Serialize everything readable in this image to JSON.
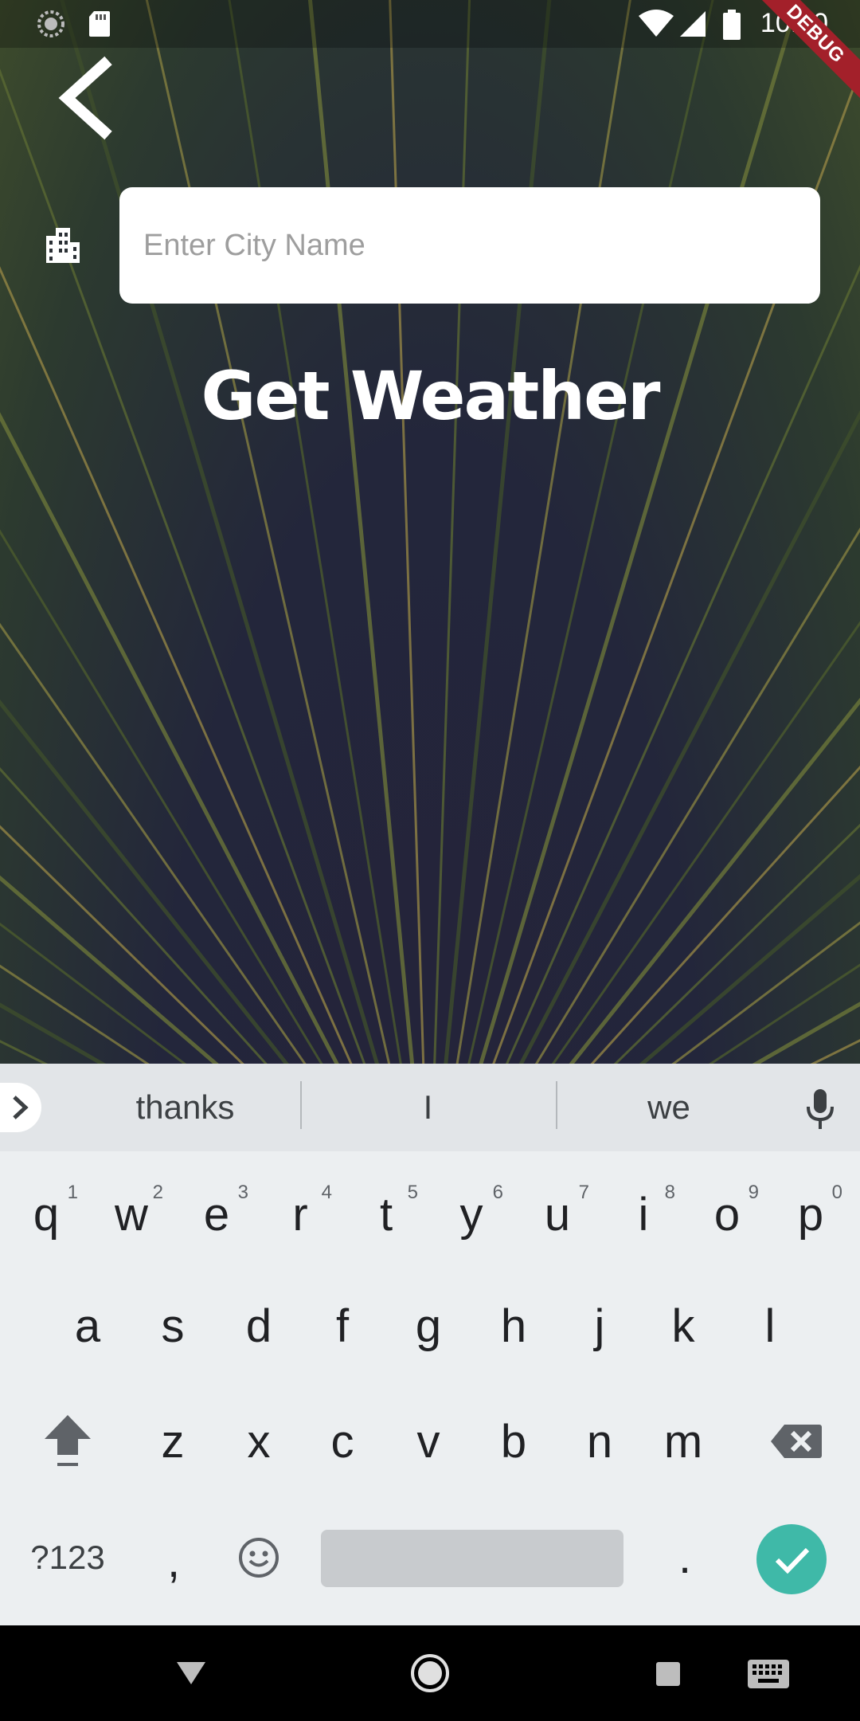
{
  "status_bar": {
    "time": "10:20",
    "icons": [
      "sync-icon",
      "sd-card-icon",
      "wifi-icon",
      "signal-icon",
      "battery-icon"
    ],
    "debug_label": "DEBUG"
  },
  "app": {
    "back_icon": "chevron-left-icon",
    "city_icon": "city-building-icon",
    "city_input": {
      "placeholder": "Enter City Name",
      "value": ""
    },
    "get_weather_label": "Get Weather",
    "colors": {
      "text": "#ffffff",
      "input_bg": "#ffffff"
    }
  },
  "keyboard": {
    "suggestions": [
      "thanks",
      "I",
      "we"
    ],
    "row1": [
      {
        "key": "q",
        "hint": "1"
      },
      {
        "key": "w",
        "hint": "2"
      },
      {
        "key": "e",
        "hint": "3"
      },
      {
        "key": "r",
        "hint": "4"
      },
      {
        "key": "t",
        "hint": "5"
      },
      {
        "key": "y",
        "hint": "6"
      },
      {
        "key": "u",
        "hint": "7"
      },
      {
        "key": "i",
        "hint": "8"
      },
      {
        "key": "o",
        "hint": "9"
      },
      {
        "key": "p",
        "hint": "0"
      }
    ],
    "row2": [
      "a",
      "s",
      "d",
      "f",
      "g",
      "h",
      "j",
      "k",
      "l"
    ],
    "row3": [
      "z",
      "x",
      "c",
      "v",
      "b",
      "n",
      "m"
    ],
    "symbols_label": "?123",
    "comma": ",",
    "period": ".",
    "enter_color": "#3fb9a8"
  },
  "nav_bar": {
    "icons": [
      "back-triangle-icon",
      "home-circle-icon",
      "recents-square-icon",
      "keyboard-switch-icon"
    ]
  }
}
